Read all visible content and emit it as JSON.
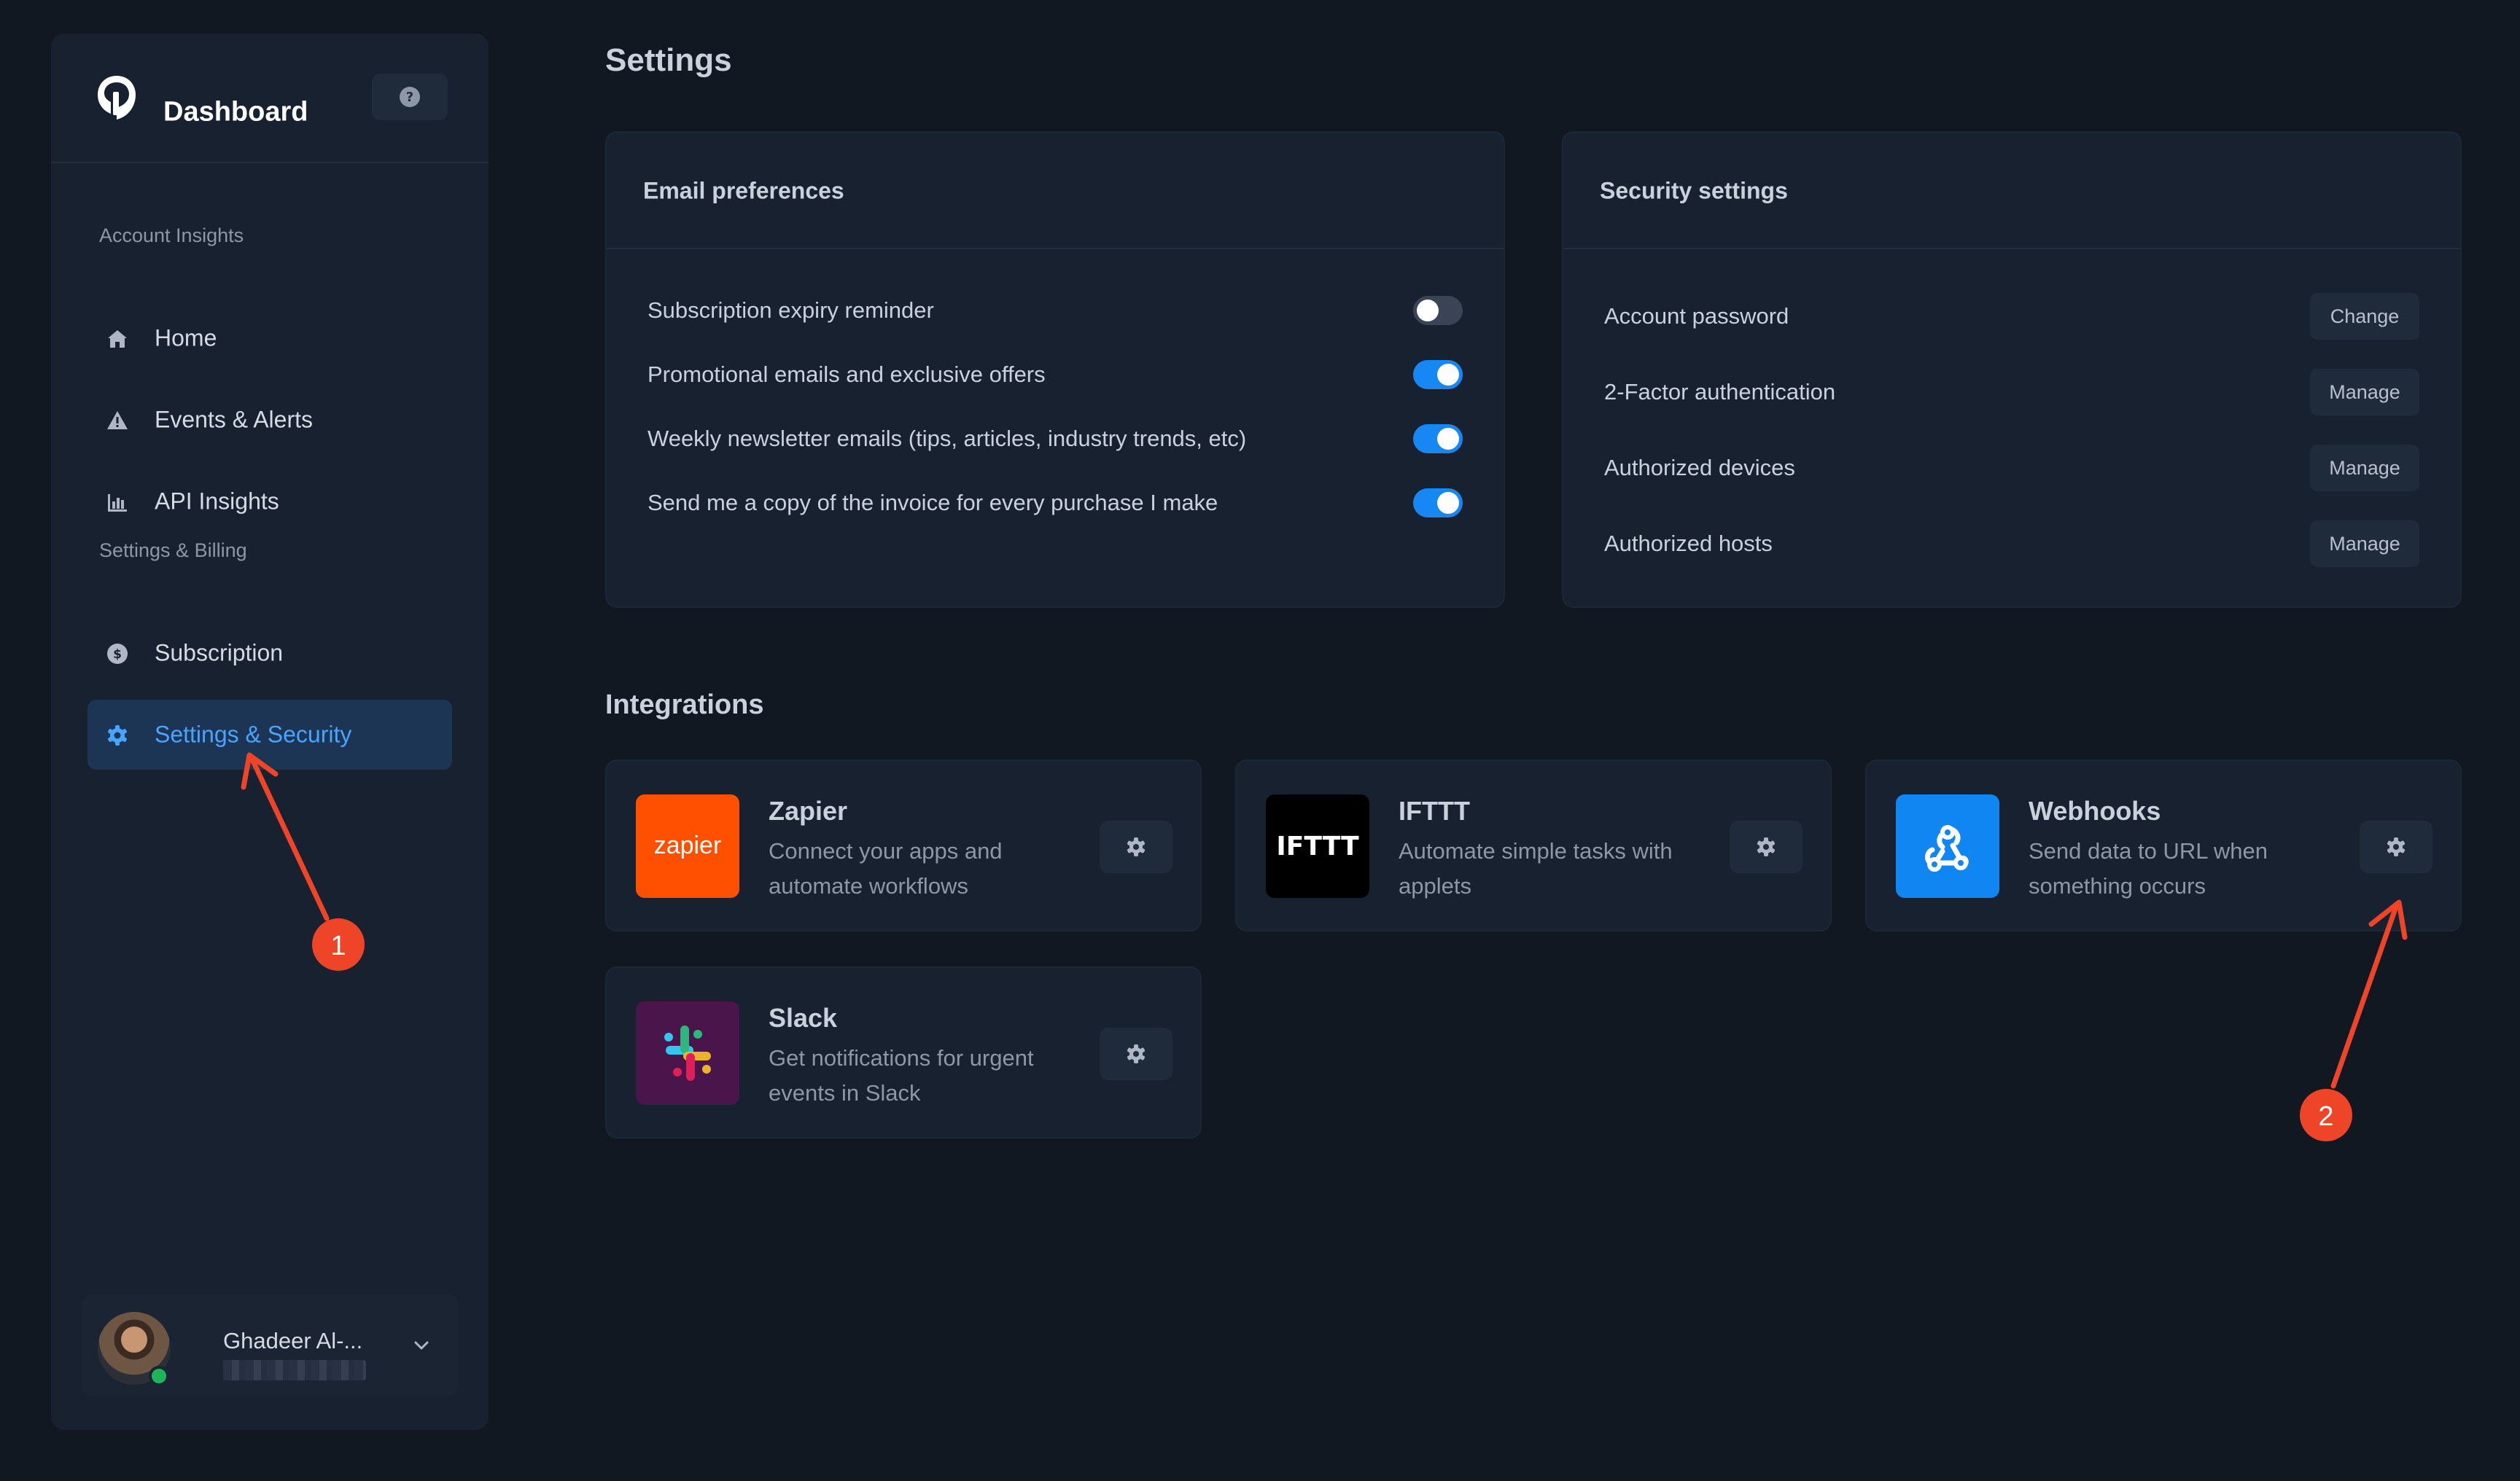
{
  "sidebar": {
    "brand": "Dashboard",
    "sections": [
      {
        "label": "Account Insights"
      },
      {
        "label": "Settings & Billing"
      }
    ],
    "items": [
      {
        "label": "Home",
        "icon": "home-icon"
      },
      {
        "label": "Events & Alerts",
        "icon": "warning-icon"
      },
      {
        "label": "API Insights",
        "icon": "bar-chart-icon"
      },
      {
        "label": "Subscription",
        "icon": "dollar-circle-icon"
      },
      {
        "label": "Settings & Security",
        "icon": "gear-icon",
        "active": true
      }
    ],
    "user": {
      "name": "Ghadeer Al-..."
    }
  },
  "main": {
    "title": "Settings",
    "email": {
      "title": "Email preferences",
      "rows": [
        {
          "label": "Subscription expiry reminder",
          "enabled": false
        },
        {
          "label": "Promotional emails and exclusive offers",
          "enabled": true
        },
        {
          "label": "Weekly newsletter emails (tips, articles, industry trends, etc)",
          "enabled": true
        },
        {
          "label": "Send me a copy of the invoice for every purchase I make",
          "enabled": true
        }
      ]
    },
    "security": {
      "title": "Security settings",
      "rows": [
        {
          "label": "Account password",
          "action": "Change"
        },
        {
          "label": "2-Factor authentication",
          "action": "Manage"
        },
        {
          "label": "Authorized devices",
          "action": "Manage"
        },
        {
          "label": "Authorized hosts",
          "action": "Manage"
        }
      ]
    },
    "integrations": {
      "title": "Integrations",
      "items": [
        {
          "name": "Zapier",
          "desc": "Connect your apps and automate workflows",
          "logo_text": "zapier",
          "color": "#ff4f00"
        },
        {
          "name": "IFTTT",
          "desc": "Automate simple tasks with applets",
          "logo_text": "IFTTT",
          "color": "#000000"
        },
        {
          "name": "Webhooks",
          "desc": "Send data to URL when something occurs",
          "color": "#0f86f2"
        },
        {
          "name": "Slack",
          "desc": "Get notifications for urgent events in Slack",
          "color": "#4a154b"
        }
      ]
    }
  },
  "annotations": [
    {
      "label": "1"
    },
    {
      "label": "2"
    }
  ],
  "colors": {
    "accent": "#1787f4",
    "annotation": "#ee4528",
    "background": "#111822",
    "panel": "#172130"
  }
}
